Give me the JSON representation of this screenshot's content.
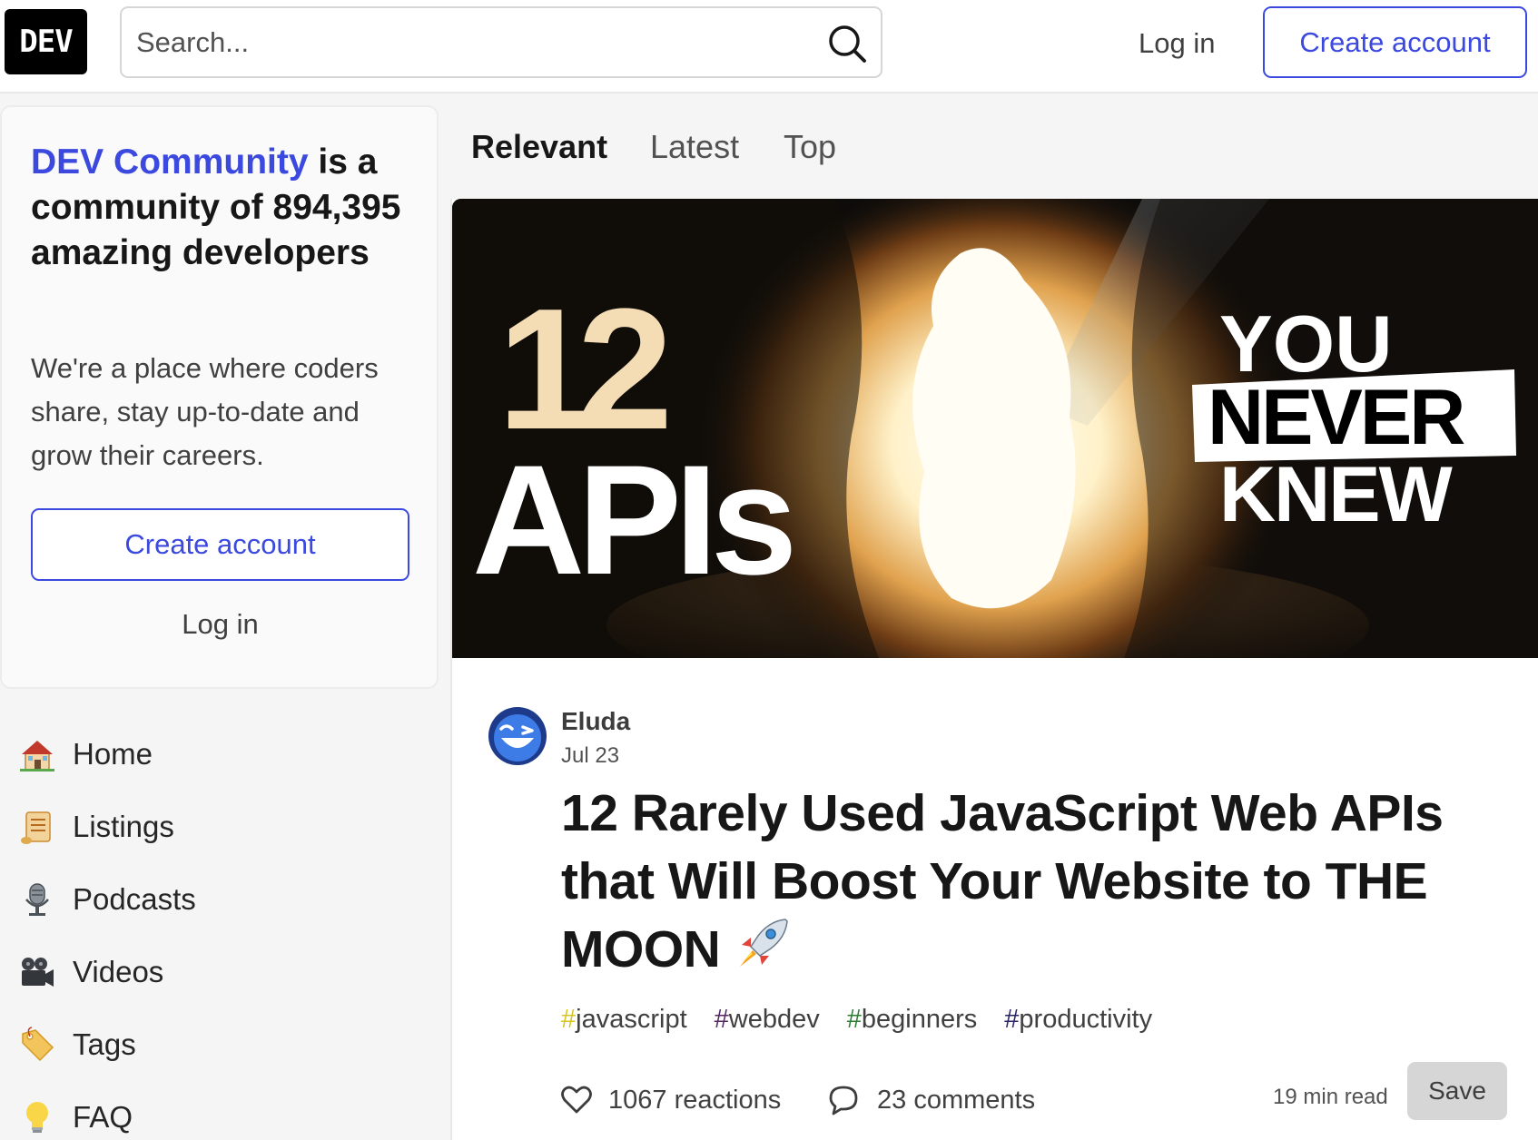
{
  "header": {
    "logo_text": "DEV",
    "search_placeholder": "Search...",
    "login_label": "Log in",
    "create_label": "Create account"
  },
  "sidebar": {
    "brand": "DEV Community",
    "title_rest": " is a community of 894,395 amazing developers",
    "description": "We're a place where coders share, stay up-to-date and grow their careers.",
    "create_label": "Create account",
    "login_label": "Log in",
    "nav": [
      {
        "label": "Home",
        "icon": "house-icon"
      },
      {
        "label": "Listings",
        "icon": "scroll-icon"
      },
      {
        "label": "Podcasts",
        "icon": "microphone-icon"
      },
      {
        "label": "Videos",
        "icon": "film-camera-icon"
      },
      {
        "label": "Tags",
        "icon": "tag-icon"
      },
      {
        "label": "FAQ",
        "icon": "lightbulb-icon"
      }
    ]
  },
  "feed": {
    "tabs": [
      "Relevant",
      "Latest",
      "Top"
    ],
    "active_tab": "Relevant"
  },
  "article": {
    "cover": {
      "big_number": "12",
      "apis_text": "APIs",
      "you_text": "YOU",
      "never_text": "NEVER",
      "knew_text": "KNEW"
    },
    "author": "Eluda",
    "date": "Jul 23",
    "title": "12 Rarely Used JavaScript Web APIs that Will Boost Your Website to THE MOON",
    "title_emoji_icon": "rocket-icon",
    "tags": [
      {
        "hash": "#",
        "name": "javascript",
        "color": "#d6c51f"
      },
      {
        "hash": "#",
        "name": "webdev",
        "color": "#562765"
      },
      {
        "hash": "#",
        "name": "beginners",
        "color": "#2e7d32"
      },
      {
        "hash": "#",
        "name": "productivity",
        "color": "#2a2566"
      }
    ],
    "reactions": "1067 reactions",
    "comments": "23 comments",
    "read_time": "19 min read",
    "save_label": "Save"
  },
  "colors": {
    "brand": "#3b49df",
    "cover_number": "#f4dcb4"
  }
}
